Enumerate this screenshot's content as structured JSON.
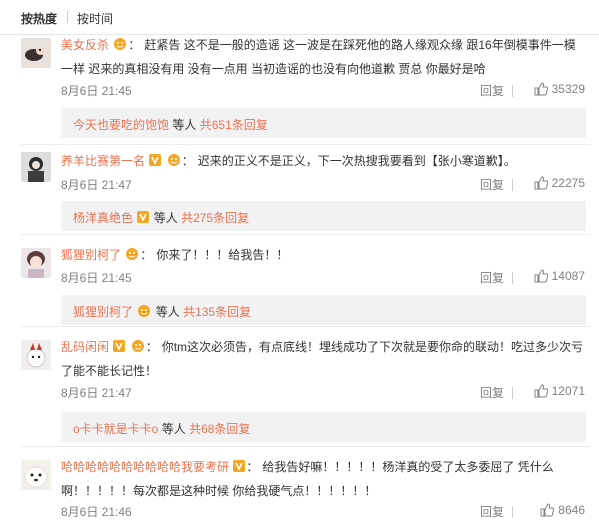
{
  "sort": {
    "tabs": [
      "按热度",
      "按时间"
    ]
  },
  "comments": [
    {
      "user": "美女反杀",
      "text": "赶紧告 这不是一般的造谣 这一波是在踩死他的路人缘观众缘 跟16年倒模事件一模一样 迟来的真相没有用 没有一点用 当初造谣的也没有向他道歉 贾总 你最好是哈",
      "time": "8月6日 21:45",
      "reply_label": "回复",
      "likes": "35329",
      "reply_user": "今天也要吃的饱饱",
      "reply_mid": "等人",
      "reply_count": "共651条回复"
    },
    {
      "user": "养羊比赛第一名",
      "text": "迟来的正义不是正义，下一次热搜我要看到【张小寒道歉】。",
      "time": "8月6日 21:47",
      "reply_label": "回复",
      "likes": "22275",
      "reply_user": "杨洋真绝色",
      "reply_mid": "等人",
      "reply_count": "共275条回复"
    },
    {
      "user": "狐狸别柯了",
      "text": "你来了！！！给我告！！",
      "time": "8月6日 21:45",
      "reply_label": "回复",
      "likes": "14087",
      "reply_user": "狐狸别柯了",
      "reply_mid": "等人",
      "reply_count": "共135条回复"
    },
    {
      "user": "乱码闲闲",
      "text": "你tm这次必须告，有点底线！埋线成功了下次就是要你命的联动！吃过多少次亏了能不能长记性！",
      "time": "8月6日 21:47",
      "reply_label": "回复",
      "likes": "12071",
      "reply_user": "o卡卡就是卡卡o",
      "reply_mid": "等人",
      "reply_count": "共68条回复"
    },
    {
      "user": "哈哈哈哈哈哈哈哈哈哈我要考研",
      "text": "给我告好嘛！！！！！杨洋真的受了太多委屈了 凭什么啊！！！！！每次都是这种时候 你给我硬气点！！！！！！",
      "time": "8月6日 21:46",
      "reply_label": "回复",
      "likes": "8646"
    }
  ],
  "colors": {
    "username": "#eb7350",
    "meta": "#808080",
    "reply_bg": "#f2f2f5",
    "badge": "#f5a623"
  }
}
